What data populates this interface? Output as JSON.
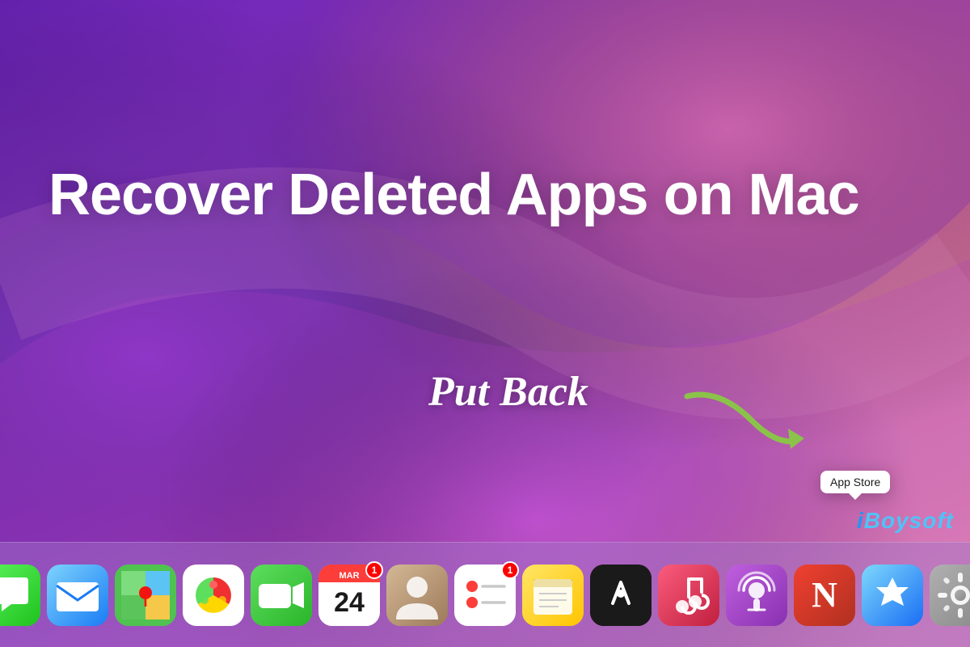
{
  "desktop": {
    "title": "Recover Deleted Apps on Mac",
    "put_back_label": "Put Back",
    "arrow_color": "#8bc34a",
    "watermark": "iBoysoft",
    "tooltip": {
      "label": "App Store"
    }
  },
  "dock": {
    "apps": [
      {
        "id": "messages",
        "label": "Messages",
        "emoji": "💬",
        "class": "app-messages",
        "badge": null
      },
      {
        "id": "mail",
        "label": "Mail",
        "emoji": "✉️",
        "class": "app-mail",
        "badge": null
      },
      {
        "id": "maps",
        "label": "Maps",
        "emoji": "🗺️",
        "class": "app-maps",
        "badge": null
      },
      {
        "id": "photos",
        "label": "Photos",
        "emoji": "📷",
        "class": "app-photos",
        "badge": null
      },
      {
        "id": "facetime",
        "label": "FaceTime",
        "emoji": "📹",
        "class": "app-facetime",
        "badge": null
      },
      {
        "id": "calendar",
        "label": "Calendar",
        "emoji": "📅",
        "class": "app-calendar",
        "badge": "1"
      },
      {
        "id": "contacts",
        "label": "Contacts",
        "emoji": "👤",
        "class": "app-contacts",
        "badge": null
      },
      {
        "id": "reminders",
        "label": "Reminders",
        "emoji": "🔴",
        "class": "app-reminders",
        "badge": "1"
      },
      {
        "id": "notes",
        "label": "Notes",
        "emoji": "📝",
        "class": "app-notes",
        "badge": null
      },
      {
        "id": "appletv",
        "label": "Apple TV",
        "emoji": "📺",
        "class": "app-appletv",
        "badge": null
      },
      {
        "id": "music",
        "label": "Music",
        "emoji": "🎵",
        "class": "app-music",
        "badge": null
      },
      {
        "id": "podcasts",
        "label": "Podcasts",
        "emoji": "🎙️",
        "class": "app-podcasts",
        "badge": null
      },
      {
        "id": "news",
        "label": "News",
        "emoji": "📰",
        "class": "app-news",
        "badge": null
      },
      {
        "id": "appstore",
        "label": "App Store",
        "emoji": "🅰️",
        "class": "app-appstore",
        "badge": null
      },
      {
        "id": "settings",
        "label": "System Preferences",
        "emoji": "⚙️",
        "class": "app-settings",
        "badge": null
      }
    ]
  }
}
